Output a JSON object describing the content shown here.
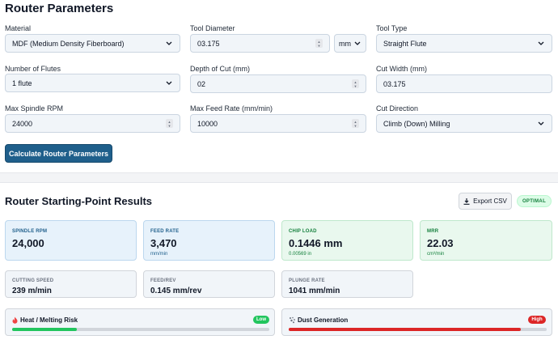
{
  "title": "Router Parameters",
  "fields": {
    "material": {
      "label": "Material",
      "value": "MDF (Medium Density Fiberboard)"
    },
    "tool_diameter": {
      "label": "Tool Diameter",
      "value": "03.175",
      "unit": "mm"
    },
    "tool_type": {
      "label": "Tool Type",
      "value": "Straight Flute"
    },
    "flutes": {
      "label": "Number of Flutes",
      "value": "1 flute"
    },
    "depth_of_cut": {
      "label": "Depth of Cut (mm)",
      "value": "02"
    },
    "cut_width": {
      "label": "Cut Width (mm)",
      "value": "03.175"
    },
    "max_rpm": {
      "label": "Max Spindle RPM",
      "value": "24000"
    },
    "max_feed": {
      "label": "Max Feed Rate (mm/min)",
      "value": "10000"
    },
    "cut_direction": {
      "label": "Cut Direction",
      "value": "Climb (Down) Milling"
    }
  },
  "calculate_label": "Calculate Router Parameters",
  "results": {
    "title": "Router Starting-Point Results",
    "export_label": "Export CSV",
    "status_badge": "OPTIMAL",
    "cards": [
      {
        "label": "SPINDLE RPM",
        "value": "24,000",
        "sub": ""
      },
      {
        "label": "FEED RATE",
        "value": "3,470",
        "sub": "mm/min"
      },
      {
        "label": "CHIP LOAD",
        "value": "0.1446 mm",
        "sub": "0.00569 in"
      },
      {
        "label": "MRR",
        "value": "22.03",
        "sub": "cm³/min"
      }
    ],
    "mini": [
      {
        "label": "CUTTING SPEED",
        "value": "239 m/min"
      },
      {
        "label": "FEED/REV",
        "value": "0.145 mm/rev"
      },
      {
        "label": "PLUNGE RATE",
        "value": "1041 mm/min"
      }
    ],
    "risks": [
      {
        "label": "Heat / Melting Risk",
        "level": "Low",
        "level_fraction": 0.25,
        "color": "#22c55e",
        "icon": "flame-icon"
      },
      {
        "label": "Dust Generation",
        "level": "High",
        "level_fraction": 0.9,
        "color": "#dc2626",
        "icon": "dust-icon"
      }
    ]
  },
  "colors": {
    "primary": "#1f5f8b",
    "blue_card": "#e7f2fb",
    "green_card": "#e9f8ee",
    "optimal_badge_bg": "#dcfce7",
    "optimal_badge_text": "#15803d"
  }
}
